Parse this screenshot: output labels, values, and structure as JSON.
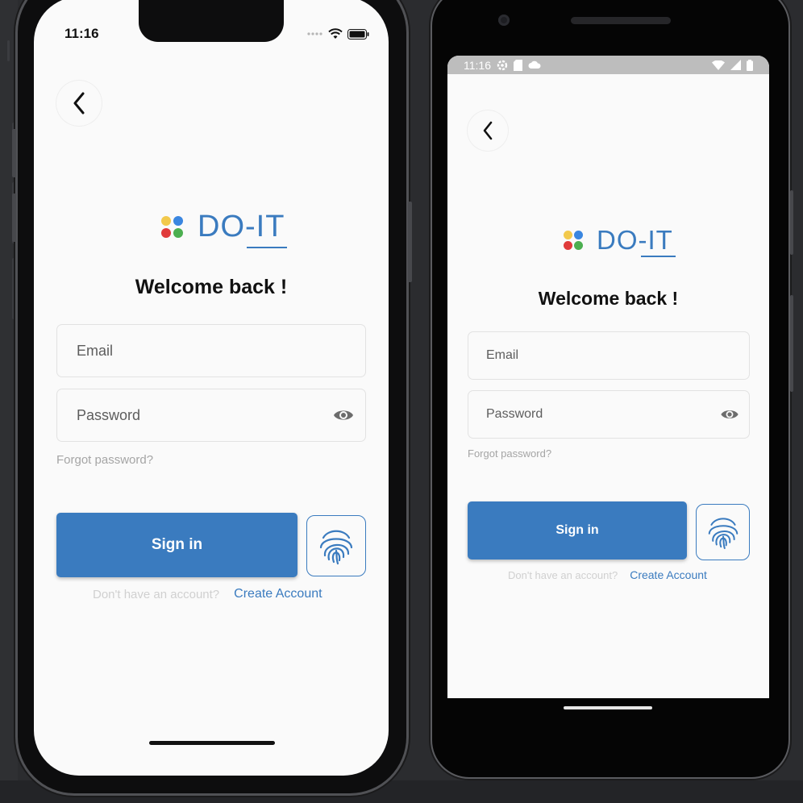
{
  "theme": {
    "brand_blue": "#3a7bbf",
    "logo_dot_colors": [
      "#f2c94c",
      "#3a86e0",
      "#e03b3b",
      "#4caf50"
    ]
  },
  "ios": {
    "status_time": "11:16",
    "status_icons": [
      "signal-dots-icon",
      "wifi-icon",
      "battery-icon"
    ]
  },
  "android": {
    "status_time": "11:16",
    "status_icons_left": [
      "settings-icon",
      "sd-card-icon",
      "cloud-icon"
    ],
    "status_icons_right": [
      "wifi-icon",
      "cell-signal-icon",
      "battery-icon"
    ]
  },
  "app": {
    "back_icon": "chevron-left-icon",
    "logo_text": "DO-IT",
    "welcome": "Welcome back !",
    "email_placeholder": "Email",
    "password_placeholder": "Password",
    "password_toggle_icon": "eye-icon",
    "forgot_password": "Forgot password?",
    "sign_in": "Sign in",
    "biometric_icon": "fingerprint-icon",
    "no_account": "Don't have an account?",
    "create_account": "Create Account"
  }
}
